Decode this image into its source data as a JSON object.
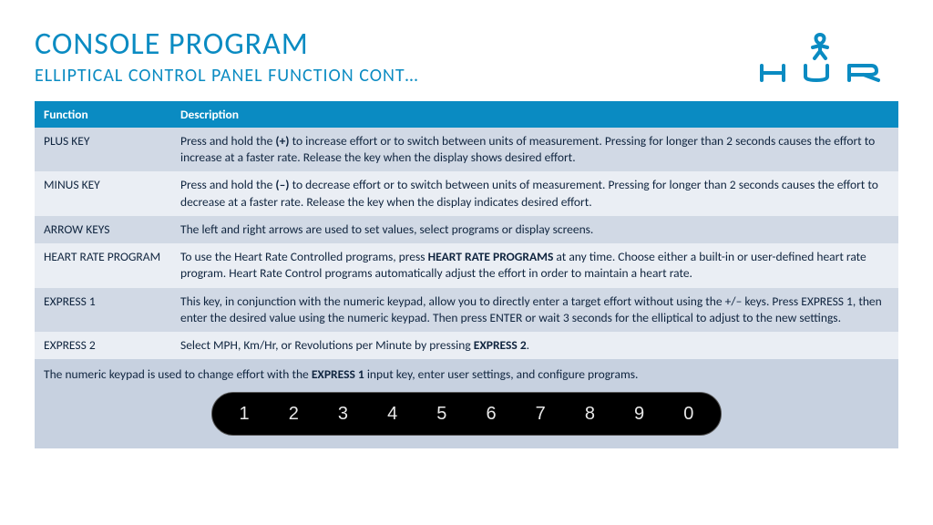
{
  "header": {
    "title": "CONSOLE PROGRAM",
    "subtitle": "ELLIPTICAL CONTROL PANEL FUNCTION CONT…",
    "brand": "HUR"
  },
  "table": {
    "col1": "Function",
    "col2": "Description",
    "rows": [
      {
        "fn": "PLUS KEY",
        "desc": "Press and hold the <b>(+)</b> to increase effort or to switch between units of measurement. Pressing for longer than 2 seconds causes the effort to increase at a faster rate. Release the key when the display shows desired effort."
      },
      {
        "fn": "MINUS KEY",
        "desc": "Press and hold the <b>(–)</b> to decrease effort or to switch between units of measurement. Pressing for longer than 2 seconds causes the effort to decrease at a faster rate. Release the key when the display indicates desired effort."
      },
      {
        "fn": "ARROW KEYS",
        "desc": "The left and right arrows are used to set values, select programs or display screens."
      },
      {
        "fn": "HEART RATE PROGRAM",
        "desc": "To use the Heart Rate Controlled programs, press <b>HEART RATE PROGRAMS</b> at any time. Choose either a built-in or user-defined heart rate program. Heart Rate Control programs automatically adjust the effort in order to maintain a heart rate."
      },
      {
        "fn": "EXPRESS 1",
        "desc": "This key, in conjunction with the numeric keypad, allow you to directly enter a target effort without using the +/– keys. Press EXPRESS 1, then enter the desired value using the numeric keypad. Then press ENTER or wait 3 seconds for the elliptical to adjust to the new settings."
      },
      {
        "fn": "EXPRESS 2",
        "desc": "Select MPH, Km/Hr, or Revolutions per Minute by pressing <b>EXPRESS 2</b>."
      }
    ],
    "footnote": "The numeric keypad is used to change effort with the <b>EXPRESS 1</b> input key, enter user settings, and configure programs."
  },
  "keypad": [
    "1",
    "2",
    "3",
    "4",
    "5",
    "6",
    "7",
    "8",
    "9",
    "0"
  ]
}
